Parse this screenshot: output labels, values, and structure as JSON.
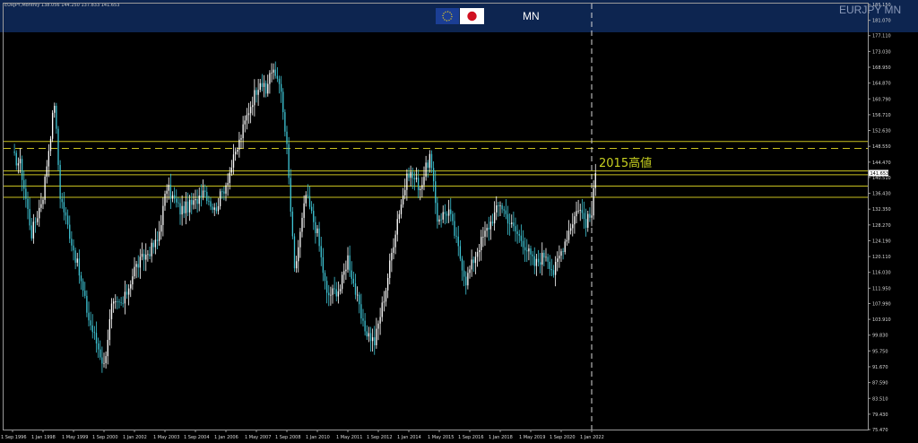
{
  "header": {
    "info": "EURJPY,Monthly  138.056 144.250 137.833 141.653",
    "timeframe": "MN",
    "symbol": "EURJPY MN",
    "flag_left": "eu-flag-icon",
    "flag_right": "jp-flag-icon"
  },
  "colors": {
    "background": "#000000",
    "header_bg": "#0d2550",
    "candle_up": "#ffffff",
    "candle_down": "#3ec4d4",
    "level_line": "#c8c020",
    "price_label_bg": "#ffffff",
    "grid_axis": "#9a9a9a"
  },
  "annotation": "2015高値",
  "chart_data": {
    "type": "candlestick",
    "title": "EURJPY,Monthly",
    "ylim": [
      75.47,
      185.15
    ],
    "y_ticks": [
      "185.150",
      "181.070",
      "177.110",
      "173.030",
      "168.950",
      "164.870",
      "160.790",
      "156.710",
      "152.630",
      "148.550",
      "144.470",
      "140.510",
      "136.430",
      "132.350",
      "128.270",
      "124.190",
      "120.110",
      "116.030",
      "111.950",
      "107.990",
      "103.910",
      "99.830",
      "95.750",
      "91.670",
      "87.590",
      "83.510",
      "79.430",
      "75.470"
    ],
    "x_ticks": [
      "1 Sep 1996",
      "1 Jan 1998",
      "1 May 1999",
      "1 Sep 2000",
      "1 Jan 2002",
      "1 May 2003",
      "1 Sep 2004",
      "1 Jan 2006",
      "1 May 2007",
      "1 Sep 2008",
      "1 Jan 2010",
      "1 May 2011",
      "1 Sep 2012",
      "1 Jan 2014",
      "1 May 2015",
      "1 Sep 2016",
      "1 Jan 2018",
      "1 May 2019",
      "1 Sep 2020",
      "1 Jan 2022"
    ],
    "current_price": "141.653",
    "horizontal_levels": [
      {
        "price": 149.8,
        "style": "solid"
      },
      {
        "price": 148.0,
        "style": "dashed"
      },
      {
        "price": 142.2,
        "style": "solid"
      },
      {
        "price": 141.2,
        "style": "solid"
      },
      {
        "price": 138.3,
        "style": "solid"
      },
      {
        "price": 135.4,
        "style": "solid"
      }
    ],
    "vertical_marker": "1 Jan 2022",
    "close_path": [
      [
        "1 Sep 1996",
        146.0
      ],
      [
        "1 Jan 1997",
        144.0
      ],
      [
        "1 Jul 1997",
        126.0
      ],
      [
        "1 Jan 1998",
        136.0
      ],
      [
        "1 Jul 1998",
        160.0
      ],
      [
        "1 Oct 1998",
        136.0
      ],
      [
        "1 Jul 1999",
        118.0
      ],
      [
        "1 Jan 2000",
        104.0
      ],
      [
        "1 Sep 2000",
        92.0
      ],
      [
        "1 Jan 2001",
        107.0
      ],
      [
        "1 Jul 2001",
        108.0
      ],
      [
        "1 Jan 2002",
        117.0
      ],
      [
        "1 Jan 2003",
        124.0
      ],
      [
        "1 Jun 2003",
        138.0
      ],
      [
        "1 Jan 2004",
        132.0
      ],
      [
        "1 Sep 2004",
        134.0
      ],
      [
        "1 Jan 2005",
        138.0
      ],
      [
        "1 Jul 2005",
        132.0
      ],
      [
        "1 Jan 2006",
        139.0
      ],
      [
        "1 Jul 2006",
        148.0
      ],
      [
        "1 Jan 2007",
        158.0
      ],
      [
        "1 Jul 2007",
        166.0
      ],
      [
        "1 Oct 2007",
        162.0
      ],
      [
        "1 Dec 2007",
        168.0
      ],
      [
        "1 May 2008",
        166.0
      ],
      [
        "1 Sep 2008",
        148.0
      ],
      [
        "1 Jan 2009",
        116.0
      ],
      [
        "1 Jul 2009",
        136.0
      ],
      [
        "1 Jan 2010",
        126.0
      ],
      [
        "1 Jun 2010",
        110.0
      ],
      [
        "1 Jan 2011",
        112.0
      ],
      [
        "1 May 2011",
        120.0
      ],
      [
        "1 Jan 2012",
        102.0
      ],
      [
        "1 Jul 2012",
        98.0
      ],
      [
        "1 Jan 2013",
        112.0
      ],
      [
        "1 Jul 2013",
        130.0
      ],
      [
        "1 Jan 2014",
        142.0
      ],
      [
        "1 Jul 2014",
        138.0
      ],
      [
        "1 Dec 2014",
        146.0
      ],
      [
        "1 Apr 2015",
        130.0
      ],
      [
        "1 Oct 2015",
        132.0
      ],
      [
        "1 Jul 2016",
        114.0
      ],
      [
        "1 Jan 2017",
        122.0
      ],
      [
        "1 Jan 2018",
        134.0
      ],
      [
        "1 Jul 2018",
        128.0
      ],
      [
        "1 Jan 2019",
        124.0
      ],
      [
        "1 Jul 2019",
        118.0
      ],
      [
        "1 Jan 2020",
        121.0
      ],
      [
        "1 May 2020",
        116.0
      ],
      [
        "1 Jan 2021",
        127.0
      ],
      [
        "1 Jun 2021",
        133.0
      ],
      [
        "1 Oct 2021",
        129.0
      ],
      [
        "1 Jan 2022",
        131.0
      ],
      [
        "1 Mar 2022",
        141.653
      ]
    ]
  }
}
